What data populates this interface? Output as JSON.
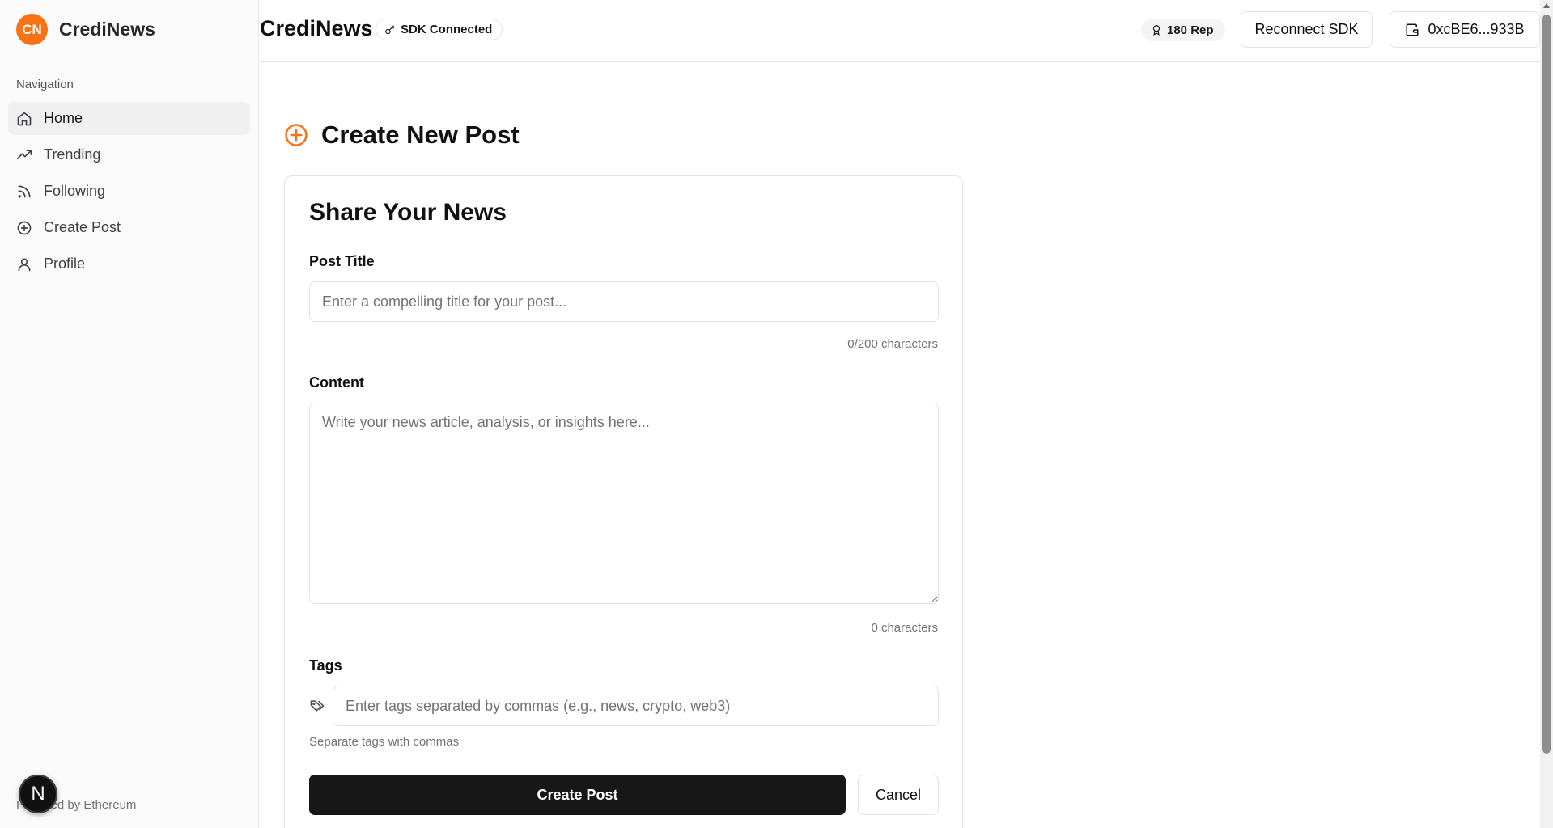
{
  "app": {
    "logo_text": "CN",
    "name": "CrediNews"
  },
  "sidebar": {
    "heading": "Navigation",
    "items": [
      {
        "label": "Home",
        "icon": "home-icon",
        "active": true
      },
      {
        "label": "Trending",
        "icon": "trending-up-icon"
      },
      {
        "label": "Following",
        "icon": "rss-icon"
      },
      {
        "label": "Create Post",
        "icon": "plus-circle-icon"
      },
      {
        "label": "Profile",
        "icon": "user-icon"
      }
    ],
    "footer": "Powered by Ethereum",
    "dev_badge": "N"
  },
  "header": {
    "title": "CrediNews",
    "sdk_status": "SDK Connected",
    "reputation": "180 Rep",
    "reconnect_label": "Reconnect SDK",
    "wallet_address": "0xcBE6...933B"
  },
  "page": {
    "title": "Create New Post",
    "title_icon": "plus-circle-icon",
    "accent_color": "#f97316"
  },
  "form": {
    "card_title": "Share Your News",
    "title_label": "Post Title",
    "title_placeholder": "Enter a compelling title for your post...",
    "title_value": "",
    "title_counter": "0/200 characters",
    "content_label": "Content",
    "content_placeholder": "Write your news article, analysis, or insights here...",
    "content_value": "",
    "content_counter": "0 characters",
    "tags_label": "Tags",
    "tags_placeholder": "Enter tags separated by commas (e.g., news, crypto, web3)",
    "tags_value": "",
    "tags_hint": "Separate tags with commas",
    "submit_label": "Create Post",
    "cancel_label": "Cancel"
  }
}
